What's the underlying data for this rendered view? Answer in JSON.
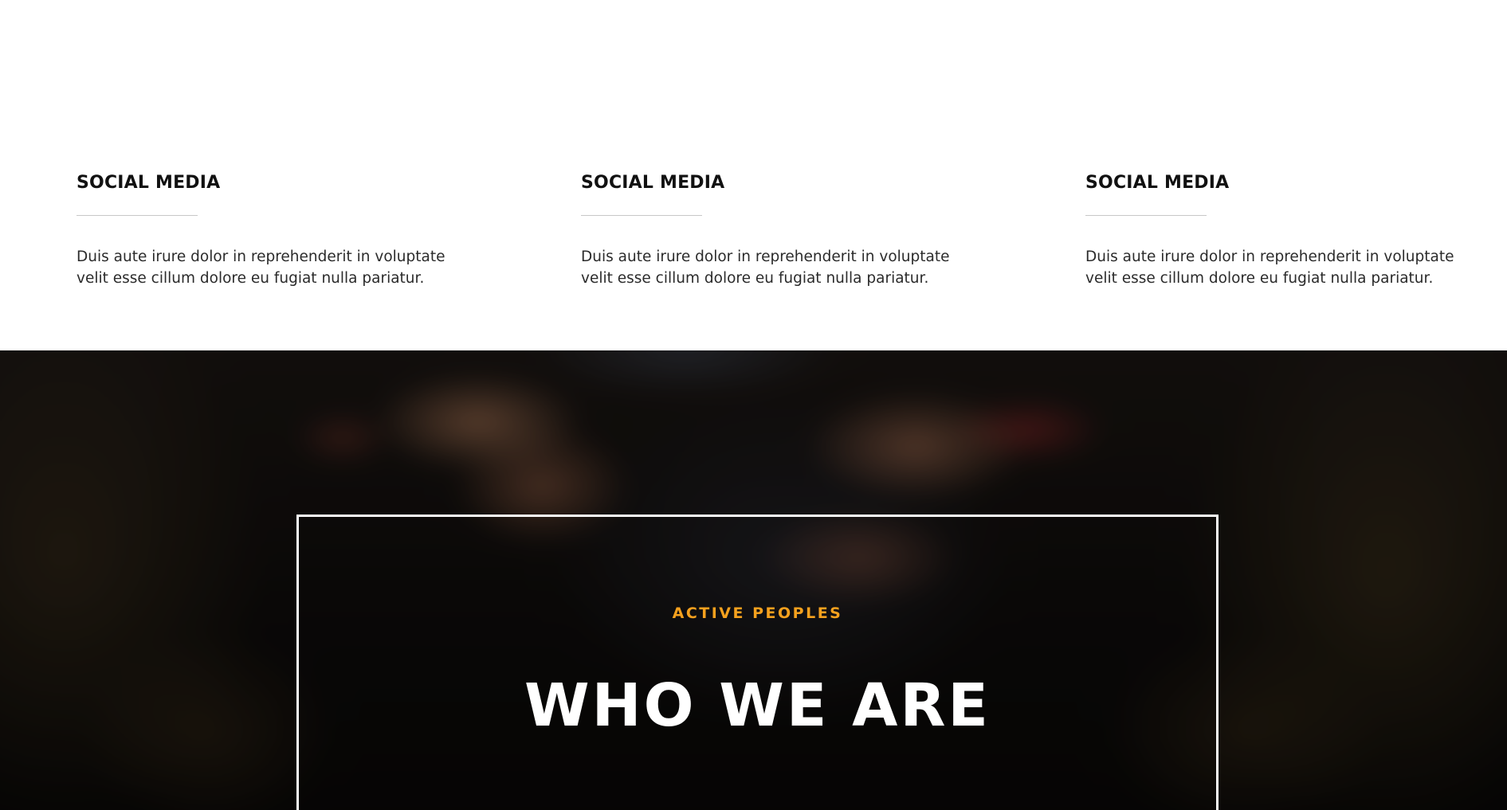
{
  "features": {
    "items": [
      {
        "title": "SOCIAL MEDIA",
        "text": "Duis aute irure dolor in reprehenderit in voluptate velit esse cillum dolore eu fugiat nulla pariatur."
      },
      {
        "title": "SOCIAL MEDIA",
        "text": "Duis aute irure dolor in reprehenderit in voluptate velit esse cillum dolore eu fugiat nulla pariatur."
      },
      {
        "title": "SOCIAL MEDIA",
        "text": "Duis aute irure dolor in reprehenderit in voluptate velit esse cillum dolore eu fugiat nulla pariatur."
      }
    ]
  },
  "hero": {
    "eyebrow": "ACTIVE PEOPLES",
    "heading": "WHO WE ARE"
  },
  "colors": {
    "accent": "#f5a11e",
    "heading_dark": "#111111",
    "body_text": "#2b2b2b",
    "hero_text": "#ffffff"
  }
}
